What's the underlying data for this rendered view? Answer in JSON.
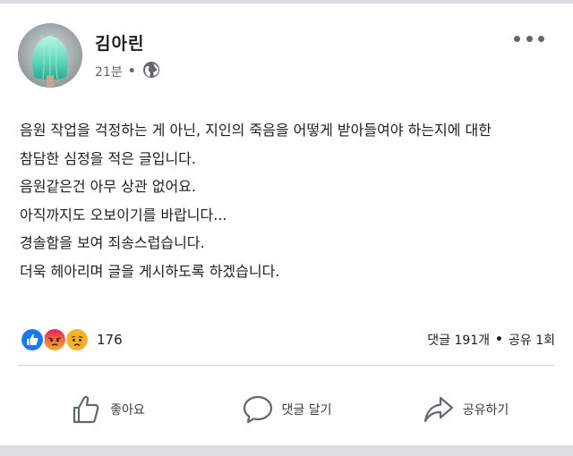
{
  "post": {
    "author": "김아린",
    "time": "21분",
    "separator": "•",
    "privacy_icon": "globe-icon",
    "lines": [
      "음원 작업을 걱정하는 게 아닌, 지인의 죽음을 어떻게 받아들여야 하는지에 대한",
      "참담한 심정을 적은 글입니다.",
      "음원같은건 아무 상관 없어요.",
      "아직까지도 오보이기를 바랍니다...",
      "경솔함을 보여 죄송스럽습니다.",
      "더욱 헤아리며 글을 게시하도록 하겠습니다."
    ]
  },
  "stats": {
    "reaction_icons": [
      "like-reaction-icon",
      "angry-reaction-icon",
      "sad-reaction-icon"
    ],
    "reaction_count": "176",
    "comments": "댓글 191개",
    "separator": "•",
    "shares": "공유 1회"
  },
  "actions": {
    "like": "좋아요",
    "comment": "댓글 달기",
    "share": "공유하기"
  },
  "colors": {
    "like_blue": "#1877f2",
    "angry_red": "#e9710f",
    "sad_yellow": "#f7b125"
  }
}
